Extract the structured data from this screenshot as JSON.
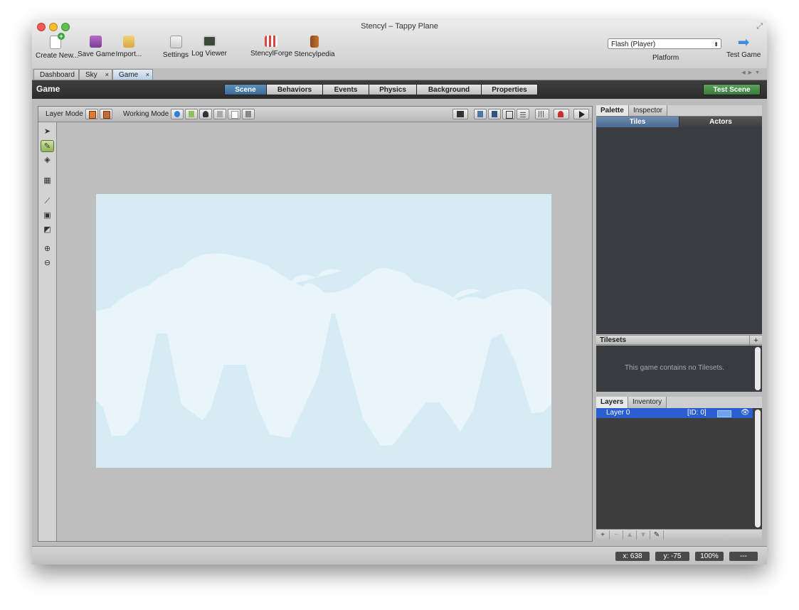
{
  "window": {
    "title": "Stencyl – Tappy Plane"
  },
  "toolbar": {
    "create_new": "Create New...",
    "save_game": "Save Game",
    "import": "Import...",
    "settings": "Settings",
    "log_viewer": "Log Viewer",
    "stencylforge": "StencylForge",
    "stencylpedia": "Stencylpedia",
    "platform_value": "Flash (Player)",
    "platform_label": "Platform",
    "test_game": "Test Game"
  },
  "doc_tabs": [
    {
      "label": "Dashboard"
    },
    {
      "label": "Sky",
      "close": "×"
    },
    {
      "label": "Game",
      "close": "×"
    }
  ],
  "header": {
    "title": "Game",
    "segments": [
      "Scene",
      "Behaviors",
      "Events",
      "Physics",
      "Background",
      "Properties"
    ],
    "active_segment": "Scene",
    "test_scene": "Test Scene"
  },
  "editor_toolbar": {
    "layer_mode": "Layer Mode",
    "working_mode": "Working Mode"
  },
  "right_panel": {
    "tabs": [
      "Palette",
      "Inspector"
    ],
    "subtabs": [
      "Tiles",
      "Actors"
    ],
    "tilesets_title": "Tilesets",
    "tilesets_add": "+",
    "tilesets_empty": "This game contains no Tilesets.",
    "layer_tabs": [
      "Layers",
      "Inventory"
    ],
    "layers": [
      {
        "name": "Layer 0",
        "id": "[ID: 0]"
      }
    ]
  },
  "status": {
    "x": "x:  638",
    "y": "y:  -75",
    "zoom": "100%",
    "extra": "---"
  },
  "colors": {
    "scene_sky": "#d5ecf5",
    "scene_clouds": "#e9f5fa",
    "active_tab": "#3c6d99",
    "test_scene": "#4c914d",
    "layer_selected": "#2a5fd1"
  }
}
